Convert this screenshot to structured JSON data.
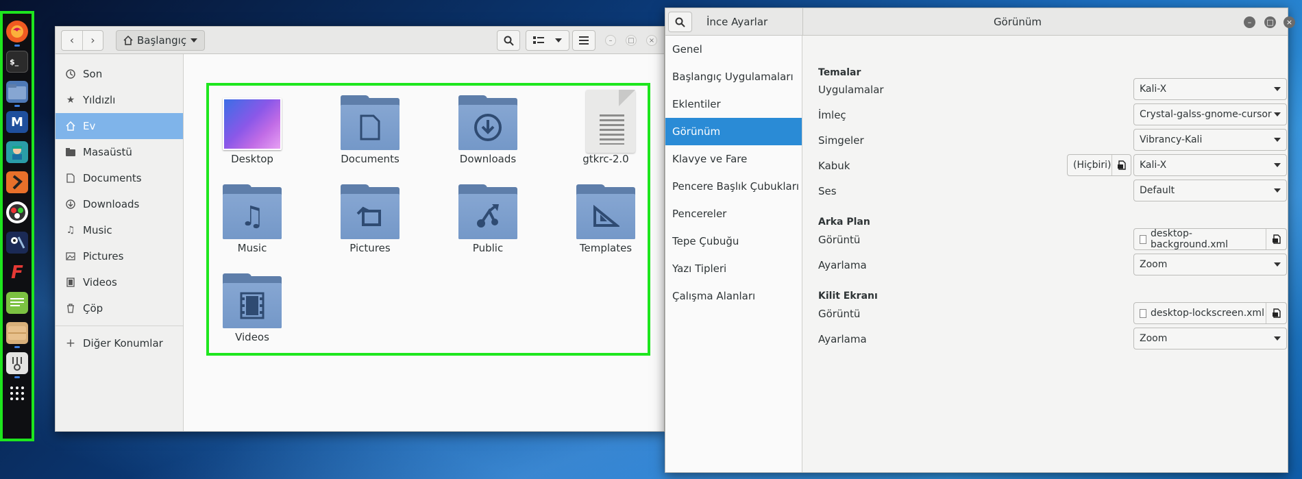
{
  "files": {
    "path": "Başlangıç",
    "sidebar": [
      {
        "label": "Son",
        "icon": "clock-icon"
      },
      {
        "label": "Yıldızlı",
        "icon": "star-icon"
      },
      {
        "label": "Ev",
        "icon": "home-icon"
      },
      {
        "label": "Masaüstü",
        "icon": "folder-icon"
      },
      {
        "label": "Documents",
        "icon": "document-icon"
      },
      {
        "label": "Downloads",
        "icon": "download-icon"
      },
      {
        "label": "Music",
        "icon": "music-icon"
      },
      {
        "label": "Pictures",
        "icon": "pictures-icon"
      },
      {
        "label": "Videos",
        "icon": "video-icon"
      },
      {
        "label": "Çöp",
        "icon": "trash-icon"
      },
      {
        "label": "Diğer Konumlar",
        "icon": "plus-icon"
      }
    ],
    "items": [
      {
        "label": "Desktop"
      },
      {
        "label": "Documents"
      },
      {
        "label": "Downloads"
      },
      {
        "label": "gtkrc-2.0"
      },
      {
        "label": "Music"
      },
      {
        "label": "Pictures"
      },
      {
        "label": "Public"
      },
      {
        "label": "Templates"
      },
      {
        "label": "Videos"
      }
    ]
  },
  "tweaks": {
    "app_title": "İnce Ayarlar",
    "page_title": "Görünüm",
    "sidebar": [
      {
        "label": "Genel"
      },
      {
        "label": "Başlangıç Uygulamaları"
      },
      {
        "label": "Eklentiler"
      },
      {
        "label": "Görünüm"
      },
      {
        "label": "Klavye ve Fare"
      },
      {
        "label": "Pencere Başlık Çubukları"
      },
      {
        "label": "Pencereler"
      },
      {
        "label": "Tepe Çubuğu"
      },
      {
        "label": "Yazı Tipleri"
      },
      {
        "label": "Çalışma Alanları"
      }
    ],
    "themes": {
      "title": "Temalar",
      "apps_label": "Uygulamalar",
      "apps_value": "Kali-X",
      "cursor_label": "İmleç",
      "cursor_value": "Crystal-galss-gnome-cursor",
      "icons_label": "Simgeler",
      "icons_value": "Vibrancy-Kali",
      "shell_label": "Kabuk",
      "shell_none": "(Hiçbiri)",
      "shell_value": "Kali-X",
      "sound_label": "Ses",
      "sound_value": "Default"
    },
    "background": {
      "title": "Arka Plan",
      "image_label": "Görüntü",
      "image_value": "desktop-background.xml",
      "adjust_label": "Ayarlama",
      "adjust_value": "Zoom"
    },
    "lockscreen": {
      "title": "Kilit Ekranı",
      "image_label": "Görüntü",
      "image_value": "desktop-lockscreen.xml",
      "adjust_label": "Ayarlama",
      "adjust_value": "Zoom"
    }
  }
}
